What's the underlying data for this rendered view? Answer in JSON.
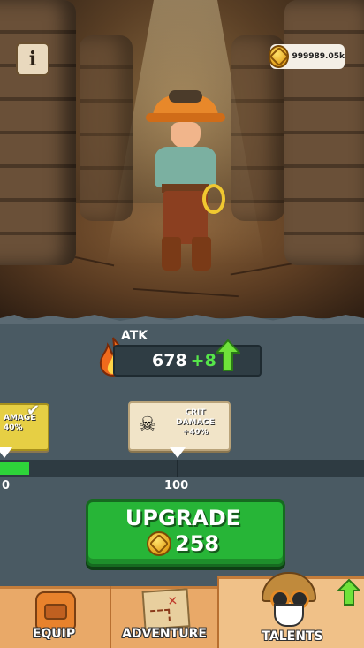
{
  "hud": {
    "info_icon": "info-icon",
    "info_glyph": "i",
    "coins": "999989.05k"
  },
  "stat": {
    "name": "ATK",
    "value": "678",
    "bonus": "+8",
    "icon": "fire-icon"
  },
  "talents": {
    "previous_card": {
      "label_line1": "AMAGE",
      "label_line2": "40%",
      "unlocked": true
    },
    "current_card": {
      "label_line1": "CRIT",
      "label_line2": "DAMAGE",
      "label_line3": "+40%",
      "icon": "skull-icon"
    }
  },
  "progress": {
    "start_label": "0",
    "end_label": "100",
    "fill_fraction": 0.08
  },
  "upgrade": {
    "label": "UPGRADE",
    "cost": "258"
  },
  "nav": {
    "tabs": [
      {
        "label": "EQUIP",
        "icon": "backpack-icon"
      },
      {
        "label": "ADVENTURE",
        "icon": "map-icon"
      },
      {
        "label": "TALENTS",
        "icon": "explorer-avatar-icon",
        "selected": true
      }
    ]
  },
  "colors": {
    "accent_green": "#27b537",
    "bonus_green": "#56e64a",
    "nav_bg": "#e9a968",
    "panel_bg": "#4a5a63"
  }
}
